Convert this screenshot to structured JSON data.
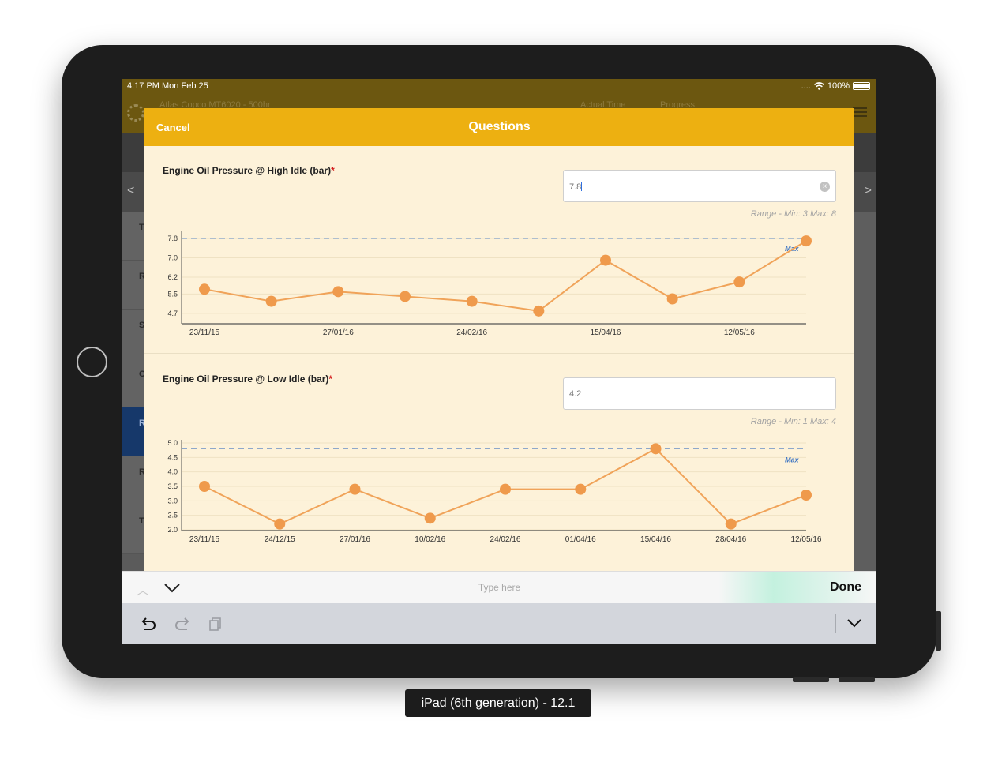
{
  "statusbar": {
    "time": "4:17 PM  Mon Feb 25",
    "battery": "100%",
    "signal": "....",
    "wifi_icon": "wifi-icon"
  },
  "app": {
    "title": "Atlas Copco MT6020 - 500hr",
    "col_actual_time": "Actual Time",
    "col_progress": "Progress",
    "nav_back": "<",
    "nav_forward": ">"
  },
  "background_rows": [
    "T",
    "R",
    "S",
    "C",
    "R",
    "R",
    "T"
  ],
  "modal": {
    "cancel_label": "Cancel",
    "title": "Questions"
  },
  "questions": [
    {
      "label": "Engine Oil Pressure @ High Idle (bar)",
      "required_mark": "*",
      "value": "7.8",
      "range": "Range - Min: 3 Max: 8"
    },
    {
      "label": "Engine Oil Pressure @ Low Idle (bar)",
      "required_mark": "*",
      "value": "4.2",
      "range": "Range - Min: 1 Max: 4"
    }
  ],
  "chart_data": [
    {
      "type": "line",
      "y_ticks": [
        "7.8",
        "7.0",
        "6.2",
        "5.5",
        "4.7"
      ],
      "y_tick_values": [
        7.8,
        7.0,
        6.2,
        5.5,
        4.7
      ],
      "ylim": [
        4.5,
        7.9
      ],
      "x_tick_labels": [
        "23/11/15",
        "27/01/16",
        "24/02/16",
        "15/04/16",
        "12/05/16"
      ],
      "series": [
        {
          "values": [
            5.7,
            5.2,
            5.6,
            5.4,
            5.2,
            4.8,
            6.9,
            5.3,
            6.0,
            7.7
          ]
        }
      ],
      "max_line": {
        "value": 7.8,
        "label": "Max"
      },
      "grid": true,
      "colors": {
        "line": "#f0a359",
        "point": "#ef9a4c",
        "max_line": "#7f9ec7"
      }
    },
    {
      "type": "line",
      "y_ticks": [
        "5.0",
        "4.5",
        "4.0",
        "3.5",
        "3.0",
        "2.5",
        "2.0"
      ],
      "y_tick_values": [
        5.0,
        4.5,
        4.0,
        3.5,
        3.0,
        2.5,
        2.0
      ],
      "ylim": [
        2.0,
        5.0
      ],
      "x_tick_labels": [
        "23/11/15",
        "24/12/15",
        "27/01/16",
        "10/02/16",
        "24/02/16",
        "01/04/16",
        "15/04/16",
        "28/04/16",
        "12/05/16"
      ],
      "series": [
        {
          "values": [
            3.5,
            2.2,
            3.4,
            2.4,
            3.4,
            3.4,
            4.8,
            2.2,
            3.2
          ]
        }
      ],
      "max_line": {
        "value": 4.8,
        "label": "Max"
      },
      "grid": true,
      "colors": {
        "line": "#f0a359",
        "point": "#ef9a4c",
        "max_line": "#7f9ec7"
      }
    }
  ],
  "keyboard": {
    "placeholder": "Type here",
    "done_label": "Done"
  },
  "simulator_label": "iPad (6th generation) - 12.1"
}
